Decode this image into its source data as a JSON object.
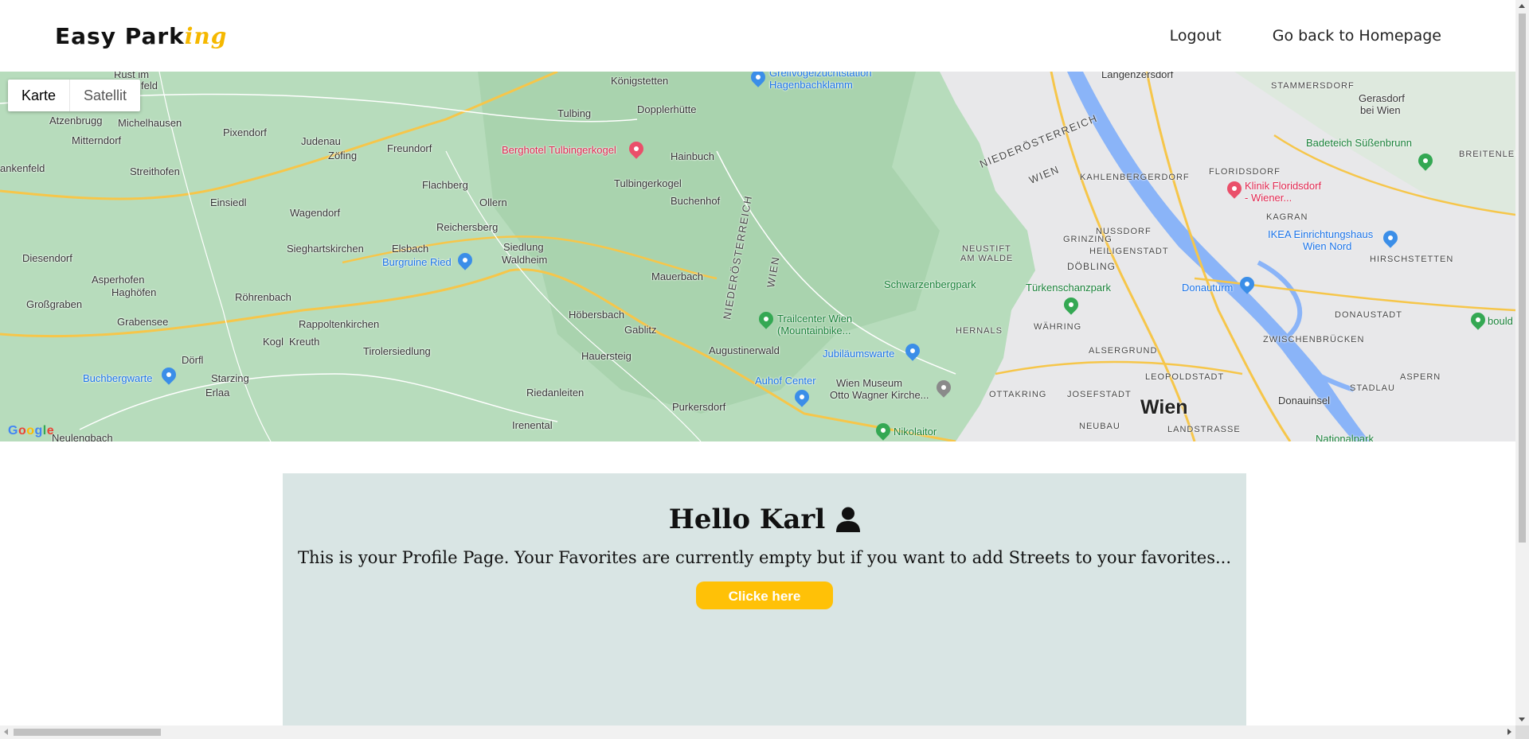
{
  "header": {
    "logo_main": "Easy Park",
    "logo_accent": "ing",
    "nav": {
      "logout": "Logout",
      "homepage": "Go back to Homepage"
    }
  },
  "map": {
    "type_controls": {
      "map": "Karte",
      "satellite": "Satellit",
      "selected": "Karte"
    },
    "attribution": "Google",
    "labels": {
      "rust": "Rust im",
      "feld": "feld",
      "koenigstetten": "Königstetten",
      "greifvogel": "Greifvogelzuchtstation",
      "hagenbachklamm": "Hagenbachklamm",
      "langenzersdorf": "Langenzersdorf",
      "stammersdorf": "STAMMERSDORF",
      "gerasdorf": "Gerasdorf",
      "bei_wien": "bei Wien",
      "dopplerhuette": "Dopplerhütte",
      "tulbing": "Tulbing",
      "atzenbrugg": "Atzenbrugg",
      "michelhausen": "Michelhausen",
      "pixendorf": "Pixendorf",
      "judenau": "Judenau",
      "mitterndorf": "Mitterndorf",
      "zoefing": "Zöfing",
      "freundorf": "Freundorf",
      "berghotel": "Berghotel Tulbingerkogel",
      "hainbuch": "Hainbuch",
      "niederoesterreich_top": "NIEDERÖSTERREICH",
      "wien_top": "WIEN",
      "kahlenbergerdorf": "KAHLENBERGERDORF",
      "floridsdorf": "FLORIDSDORF",
      "klinik": "Klinik Floridsdorf",
      "klinik2": "- Wiener...",
      "badeteich": "Badeteich Süßenbrunn",
      "breitenlee": "BREITENLEE",
      "ankenfeld": "ankenfeld",
      "streithofen": "Streithofen",
      "flachberg": "Flachberg",
      "tulbingerkogel": "Tulbingerkogel",
      "einsiedl": "Einsiedl",
      "ollern": "Ollern",
      "buchenhof": "Buchenhof",
      "nussdorf": "NUSSDORF",
      "kagran": "KAGRAN",
      "wagendorf": "Wagendorf",
      "reichersberg": "Reichersberg",
      "grinzing": "GRINZING",
      "heiligenstadt": "HEILIGENSTADT",
      "ikea": "IKEA Einrichtungshaus",
      "ikea2": "Wien Nord",
      "sieghartskirchen": "Sieghartskirchen",
      "elsbach": "Elsbach",
      "siedlung": "Siedlung",
      "waldheim": "Waldheim",
      "burgruine": "Burgruine Ried",
      "niederoesterreich_mid": "NIEDERÖSTERREICH",
      "wien_mid": "WIEN",
      "neustift": "NEUSTIFT",
      "am_walde": "AM WALDE",
      "doebling": "DÖBLING",
      "hirschstetten": "HIRSCHSTETTEN",
      "diesendorf": "Diesendorf",
      "asperhofen": "Asperhofen",
      "haghofen": "Haghöfen",
      "mauerbach": "Mauerbach",
      "schwarzenbergpark": "Schwarzenbergpark",
      "tuerkenschanzpark": "Türkenschanzpark",
      "donauturm": "Donauturm",
      "grossgraben": "Großgraben",
      "roehrenbach": "Röhrenbach",
      "grabensee": "Grabensee",
      "rappoltenkirchen": "Rappoltenkirchen",
      "hoebersbach": "Höbersbach",
      "gablitz": "Gablitz",
      "trailcenter": "Trailcenter Wien",
      "trailcenter2": "(Mountainbike...",
      "hernals": "HERNALS",
      "waehring": "WÄHRING",
      "donaustadt": "DONAUSTADT",
      "kogl": "Kogl",
      "kreuth": "Kreuth",
      "tirolersiedlung": "Tirolersiedlung",
      "zwischenbruecken": "ZWISCHENBRÜCKEN",
      "augustinerwald": "Augustinerwald",
      "alsergrund": "ALSERGRUND",
      "doerfl": "Dörfl",
      "hauersteig": "Hauersteig",
      "jubilaeumswarte": "Jubiläumswarte",
      "leopoldstadt": "LEOPOLDSTADT",
      "buchbergwarte": "Buchbergwarte",
      "starzing": "Starzing",
      "aspern": "ASPERN",
      "erlaa": "Erlaa",
      "auhof": "Auhof Center",
      "wien_museum": "Wien Museum",
      "otto_wagner": "Otto Wagner Kirche...",
      "riedanleiten": "Riedanleiten",
      "ottakring": "OTTAKRING",
      "josefstadt": "JOSEFSTADT",
      "donauinsel": "Donauinsel",
      "purkersdorf": "Purkersdorf",
      "wien": "Wien",
      "neubau": "NEUBAU",
      "landstrasse": "LANDSTRASSE",
      "irenental": "Irenental",
      "nikolaitor": "Nikolaitor",
      "neulengbach": "Neulengbach",
      "stadlau": "STADLAU",
      "nationalpark": "Nationalpark",
      "bould": "bould"
    }
  },
  "profile": {
    "greeting": "Hello Karl",
    "intro": "This is your Profile Page. Your Favorites are currently empty but if you want to add Streets to your favorites...",
    "button_label": "Clicke here"
  },
  "colors": {
    "brand_accent": "#f5b800",
    "button": "#ffc107",
    "card_bg": "#d9e5e4",
    "map_green": "#b7dcbc"
  }
}
